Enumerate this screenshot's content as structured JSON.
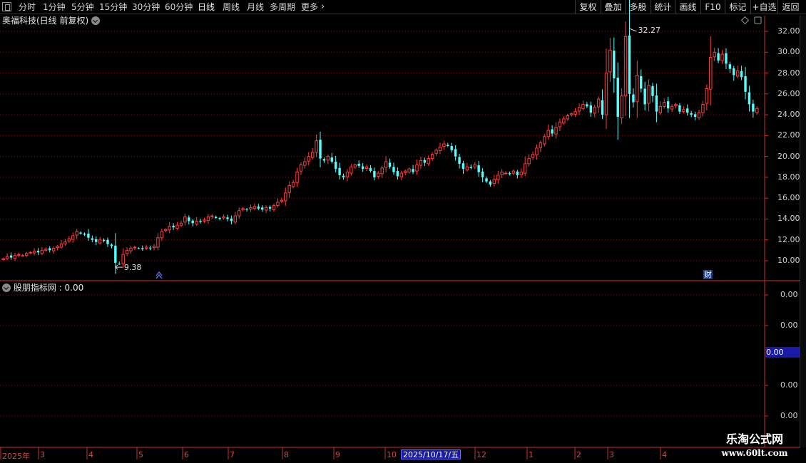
{
  "toolbar": {
    "periods": [
      "分时",
      "1分钟",
      "5分钟",
      "15分钟",
      "30分钟",
      "60分钟",
      "日线",
      "周线",
      "月线",
      "多周期",
      "更多"
    ],
    "more_arrow": "›",
    "right_buttons": [
      "复权",
      "叠加",
      "多股",
      "统计",
      "画线",
      "F10",
      "标记",
      "+自选",
      "返回"
    ]
  },
  "chart": {
    "title": "奥福科技(日线 前复权)",
    "price_ticks": [
      "32.00",
      "30.00",
      "28.00",
      "26.00",
      "24.00",
      "22.00",
      "20.00",
      "18.00",
      "16.00",
      "14.00",
      "12.00",
      "10.00"
    ],
    "high_label": "32.27",
    "low_label": "9.38",
    "cai_badge": "财"
  },
  "indicator": {
    "title": "股朋指标网 : 0.00",
    "ticks": [
      "0.00",
      "0.00",
      "0.00",
      "0.00"
    ],
    "current_value": "0.00"
  },
  "xaxis": {
    "labels": [
      "2025年",
      "3",
      "4",
      "5",
      "6",
      "7",
      "8",
      "9",
      "10",
      "12",
      "1",
      "2",
      "3",
      "4"
    ],
    "highlight": "2025/10/17/五"
  },
  "watermark": {
    "name": "乐淘公式网",
    "url": "www.60lt.com"
  },
  "colors": {
    "up": "#ff3c3c",
    "down": "#54ffff",
    "grid": "#7a1414",
    "axis": "#c83232",
    "tick_text": "#d0d0d0",
    "highlight_bg": "#1a1aa8"
  },
  "chart_data": {
    "type": "candlestick",
    "title": "奥福科技(日线 前复权)",
    "ylim": [
      9,
      33
    ],
    "annotations": [
      {
        "label": "32.27",
        "value": 32.27,
        "kind": "high"
      },
      {
        "label": "9.38",
        "value": 9.38,
        "kind": "low"
      }
    ],
    "closes": [
      10.2,
      10.4,
      10.3,
      10.5,
      10.6,
      10.5,
      10.7,
      10.8,
      10.9,
      10.8,
      11.0,
      11.1,
      11.0,
      11.2,
      11.4,
      11.6,
      11.8,
      12.1,
      12.4,
      12.8,
      12.6,
      12.5,
      12.2,
      12.0,
      11.8,
      12.0,
      11.9,
      11.6,
      11.4,
      9.8,
      9.7,
      10.6,
      11.0,
      11.2,
      11.3,
      11.2,
      11.1,
      11.3,
      11.2,
      11.4,
      12.2,
      12.8,
      13.0,
      13.3,
      13.2,
      13.4,
      13.6,
      14.2,
      13.8,
      13.6,
      13.8,
      13.7,
      13.9,
      14.2,
      14.3,
      14.1,
      14.0,
      14.2,
      14.0,
      13.8,
      14.3,
      14.8,
      15.0,
      14.9,
      15.1,
      15.2,
      15.0,
      14.9,
      15.1,
      15.0,
      15.3,
      15.6,
      15.8,
      16.5,
      17.2,
      17.5,
      18.5,
      19.2,
      19.5,
      20.0,
      20.4,
      21.5,
      19.8,
      19.6,
      20.0,
      19.5,
      18.8,
      18.2,
      18.0,
      18.5,
      19.0,
      19.2,
      19.1,
      18.8,
      19.0,
      18.6,
      18.0,
      18.4,
      18.9,
      19.5,
      19.0,
      18.5,
      18.1,
      18.4,
      18.6,
      18.8,
      18.5,
      19.2,
      19.6,
      19.4,
      19.8,
      20.2,
      20.6,
      20.9,
      21.2,
      21.0,
      20.6,
      20.0,
      19.3,
      18.8,
      19.0,
      18.9,
      19.2,
      18.5,
      18.0,
      17.6,
      17.3,
      17.8,
      18.2,
      18.5,
      18.4,
      18.3,
      18.6,
      18.2,
      18.5,
      19.3,
      19.8,
      20.2,
      20.8,
      21.3,
      21.9,
      22.5,
      22.2,
      22.8,
      23.3,
      23.6,
      23.9,
      24.1,
      24.3,
      24.7,
      25.0,
      24.8,
      24.2,
      24.7,
      25.5,
      24.0,
      28.0,
      30.2,
      27.5,
      23.8,
      25.8,
      31.5,
      26.0,
      25.2,
      27.8,
      26.5,
      25.0,
      26.8,
      25.8,
      24.3,
      24.8,
      25.2,
      24.6,
      24.8,
      25.0,
      24.3,
      24.5,
      24.2,
      24.0,
      23.8,
      24.2,
      25.0,
      26.5,
      29.5,
      30.0,
      29.2,
      29.8,
      28.9,
      28.4,
      27.8,
      28.2,
      27.6,
      26.2,
      25.0,
      24.3,
      24.6
    ]
  }
}
